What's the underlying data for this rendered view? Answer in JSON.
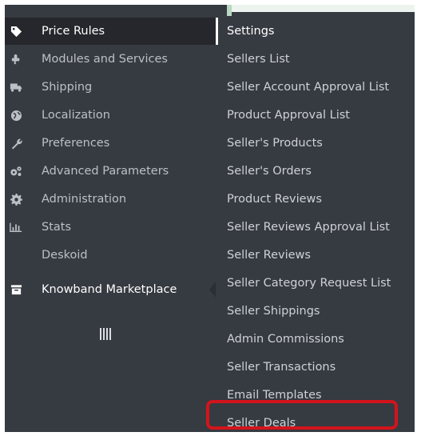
{
  "menu": {
    "items": [
      {
        "label": "Price Rules",
        "icon": "tag-icon"
      },
      {
        "label": "Modules and Services",
        "icon": "puzzle-icon"
      },
      {
        "label": "Shipping",
        "icon": "truck-icon"
      },
      {
        "label": "Localization",
        "icon": "globe-icon"
      },
      {
        "label": "Preferences",
        "icon": "wrench-icon"
      },
      {
        "label": "Advanced Parameters",
        "icon": "cogs-icon"
      },
      {
        "label": "Administration",
        "icon": "gear-icon"
      },
      {
        "label": "Stats",
        "icon": "bar-chart-icon"
      },
      {
        "label": "Deskoid",
        "icon": ""
      },
      {
        "label": "Knowband Marketplace",
        "icon": "store-icon"
      }
    ]
  },
  "submenu": {
    "items": [
      "Settings",
      "Sellers List",
      "Seller Account Approval List",
      "Product Approval List",
      "Seller's Products",
      "Seller's Orders",
      "Product Reviews",
      "Seller Reviews Approval List",
      "Seller Reviews",
      "Seller Category Request List",
      "Seller Shippings",
      "Admin Commissions",
      "Seller Transactions",
      "Email Templates",
      "Seller Deals"
    ]
  },
  "colors": {
    "sidebar_bg": "#363a41",
    "active_bg": "#25272c",
    "highlight": "#d3141c"
  }
}
